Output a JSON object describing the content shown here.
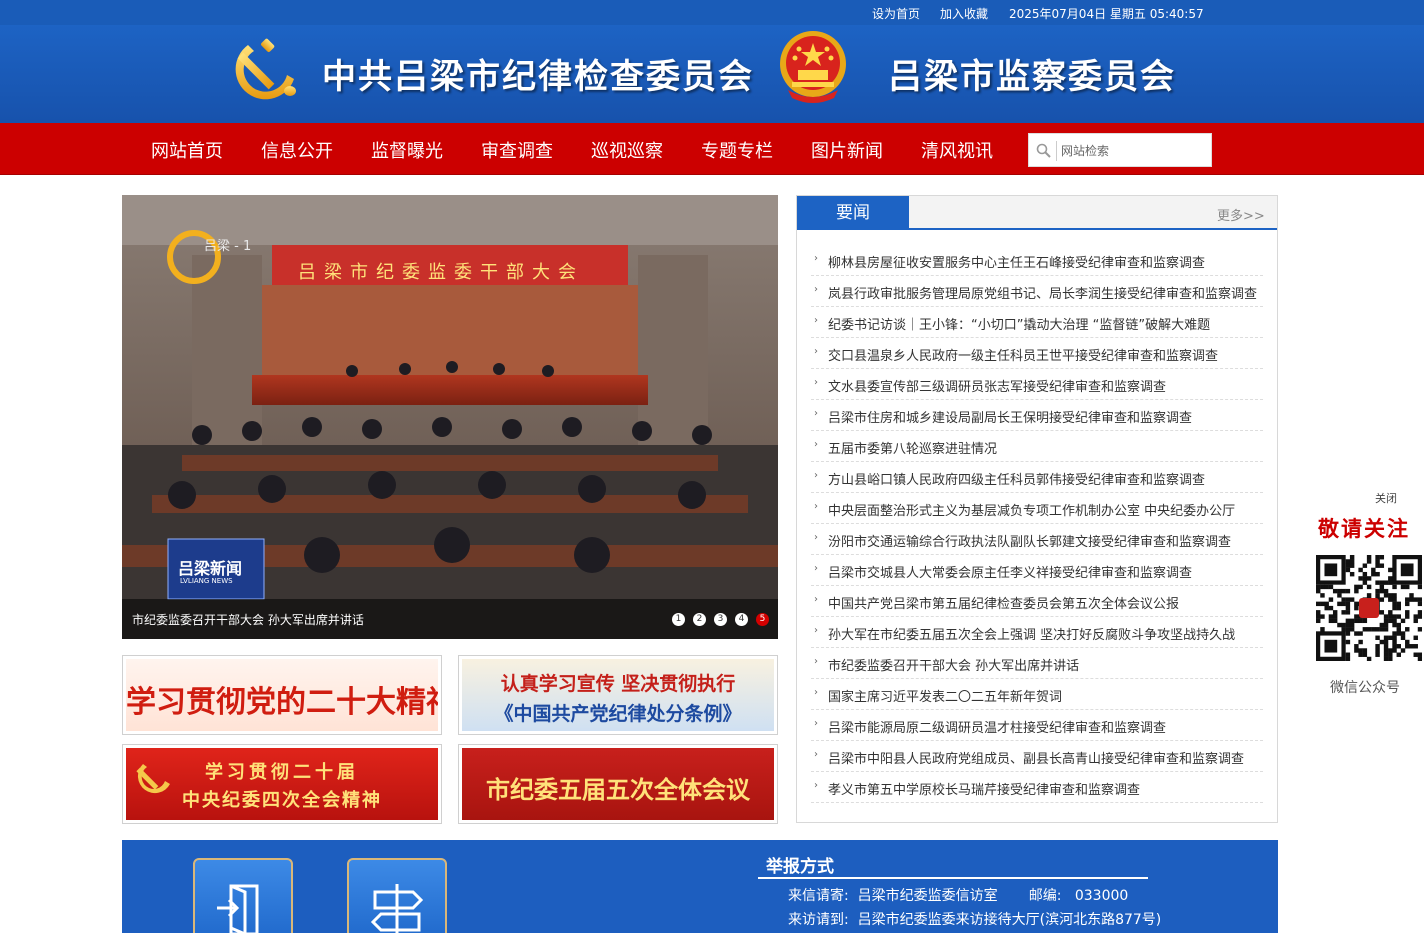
{
  "topbar": {
    "set_home": "设为首页",
    "add_favorite": "加入收藏",
    "datetime": "2025年07月04日 星期五 05:40:57"
  },
  "header": {
    "party_title": "中共吕梁市纪律检查委员会",
    "supervision_title": "吕梁市监察委员会"
  },
  "nav": {
    "items": [
      {
        "label": "网站首页"
      },
      {
        "label": "信息公开"
      },
      {
        "label": "监督曝光"
      },
      {
        "label": "审查调查"
      },
      {
        "label": "巡视巡察"
      },
      {
        "label": "专题专栏"
      },
      {
        "label": "图片新闻"
      },
      {
        "label": "清风视讯"
      }
    ],
    "search_placeholder": "网站检索"
  },
  "slideshow": {
    "station_logo": "吕梁 - 1",
    "meeting_banner": "吕梁市纪委监委干部大会",
    "program_logo": "吕梁新闻",
    "program_logo_en": "LVLIANG NEWS",
    "caption": "市纪委监委召开干部大会 孙大军出席并讲话",
    "dots": [
      "1",
      "2",
      "3",
      "4",
      "5"
    ],
    "active_dot": 5
  },
  "banners": [
    {
      "text": "学习贯彻党的二十大精神"
    },
    {
      "line1": "认真学习宣传 坚决贯彻执行",
      "line2": "《中国共产党纪律处分条例》"
    },
    {
      "line1": "学习贯彻二十届",
      "line2": "中央纪委四次全会精神"
    },
    {
      "text": "市纪委五届五次全体会议"
    }
  ],
  "news": {
    "tab": "要闻",
    "more": "更多>>",
    "items": [
      "柳林县房屋征收安置服务中心主任王石峰接受纪律审查和监察调查",
      "岚县行政审批服务管理局原党组书记、局长李润生接受纪律审查和监察调查",
      "纪委书记访谈｜王小锋：“小切口”撬动大治理 “监督链”破解大难题",
      "交口县温泉乡人民政府一级主任科员王世平接受纪律审查和监察调查",
      "文水县委宣传部三级调研员张志军接受纪律审查和监察调查",
      "吕梁市住房和城乡建设局副局长王保明接受纪律审查和监察调查",
      "五届市委第八轮巡察进驻情况",
      "方山县峪口镇人民政府四级主任科员郭伟接受纪律审查和监察调查",
      "中央层面整治形式主义为基层减负专项工作机制办公室 中央纪委办公厅",
      "汾阳市交通运输综合行政执法队副队长郭建文接受纪律审查和监察调查",
      "吕梁市交城县人大常委会原主任李义祥接受纪律审查和监察调查",
      "中国共产党吕梁市第五届纪律检查委员会第五次全体会议公报",
      "孙大军在市纪委五届五次全会上强调 坚决打好反腐败斗争攻坚战持久战",
      "市纪委监委召开干部大会 孙大军出席并讲话",
      "国家主席习近平发表二〇二五年新年贺词",
      "吕梁市能源局原二级调研员温才柱接受纪律审查和监察调查",
      "吕梁市中阳县人民政府党组成员、副县长高青山接受纪律审查和监察调查",
      "孝义市第五中学原校长马瑞芹接受纪律审查和监察调查"
    ]
  },
  "float_widget": {
    "close": "关闭",
    "follow": "敬请关注",
    "caption": "微信公众号"
  },
  "report": {
    "title": "举报方式",
    "mail_label": "来信请寄:",
    "mail_value": "吕梁市纪委监委信访室",
    "postcode_label": "邮编:",
    "postcode_value": "033000",
    "visit_label": "来访请到:",
    "visit_value": "吕梁市纪委监委来访接待大厅(滨河北东路877号)"
  },
  "colors": {
    "header_blue": "#1d63c4",
    "nav_red": "#cc0000",
    "gold": "#f2b01e"
  }
}
